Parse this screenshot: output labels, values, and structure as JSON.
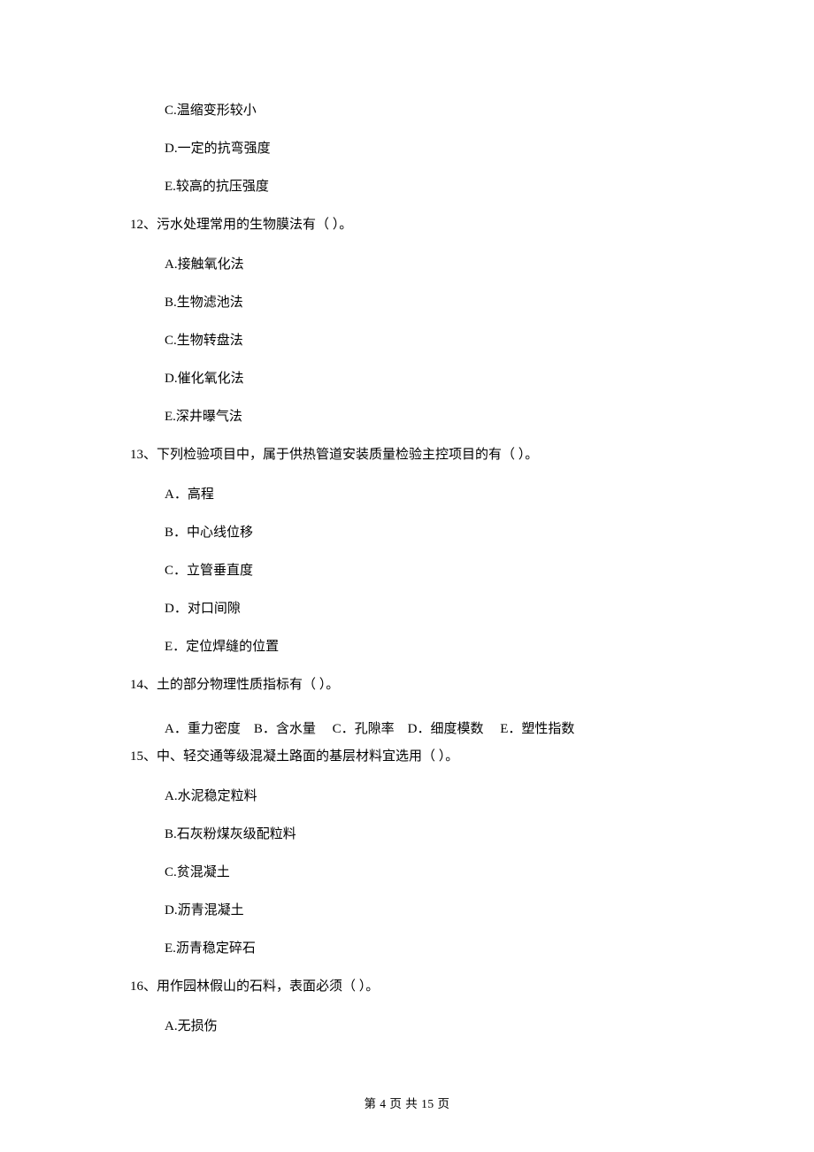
{
  "pre_options": {
    "c": "C.温缩变形较小",
    "d": "D.一定的抗弯强度",
    "e": "E.较高的抗压强度"
  },
  "q12": {
    "stem": "12、污水处理常用的生物膜法有（  ）。",
    "a": "A.接触氧化法",
    "b": "B.生物滤池法",
    "c": "C.生物转盘法",
    "d": "D.催化氧化法",
    "e": "E.深井曝气法"
  },
  "q13": {
    "stem": "13、下列检验项目中，属于供热管道安装质量检验主控项目的有（   ）。",
    "a": "A．高程",
    "b": "B．中心线位移",
    "c": "C．立管垂直度",
    "d": "D．对口间隙",
    "e": "E．定位焊缝的位置"
  },
  "q14": {
    "stem": "14、土的部分物理性质指标有（   ）。",
    "a": "A．重力密度",
    "b": "B．含水量",
    "c": "C．孔隙率",
    "d": "D．细度模数",
    "e": "E．塑性指数"
  },
  "q15": {
    "stem": "15、中、轻交通等级混凝土路面的基层材料宜选用（  ）。",
    "a": "A.水泥稳定粒料",
    "b": "B.石灰粉煤灰级配粒料",
    "c": "C.贫混凝土",
    "d": "D.沥青混凝土",
    "e": "E.沥青稳定碎石"
  },
  "q16": {
    "stem": "16、用作园林假山的石料，表面必须（  ）。",
    "a": "A.无损伤"
  },
  "footer": "第 4 页 共 15 页"
}
